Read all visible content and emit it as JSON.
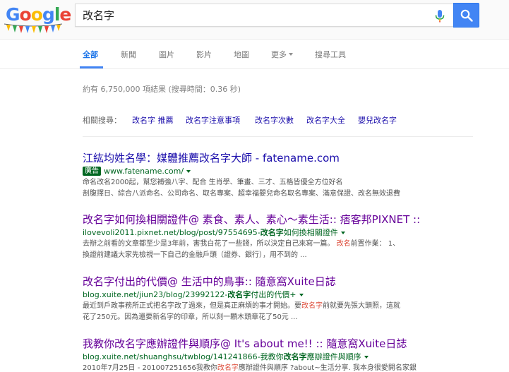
{
  "search": {
    "query": "改名字"
  },
  "tabs": [
    {
      "label": "全部",
      "active": true
    },
    {
      "label": "新聞"
    },
    {
      "label": "圖片"
    },
    {
      "label": "影片"
    },
    {
      "label": "地圖"
    },
    {
      "label": "更多"
    },
    {
      "label": "搜尋工具"
    }
  ],
  "stats": "約有 6,750,000 項結果 (搜尋時間：0.36 秒)",
  "related": {
    "label": "相關搜尋：",
    "links": [
      "改名字 推薦",
      "改名字注意事項",
      "改名字次數",
      "改名字大全",
      "嬰兒改名字"
    ]
  },
  "results": [
    {
      "title": "江紘均姓名學：媒體推薦改名字大師 - fatename.com",
      "ad_label": "廣告",
      "url": "www.fatename.com/",
      "snippet1": "命名改名2000起，幫您補強八字、配合 生肖學、筆畫、三才、五格皆優全方位好名",
      "snippet2": "剖腹擇日、綜合八派命名、公司命名、取名專案、超幸福嬰兒命名取名專案、滿意保證、改名無效退費"
    },
    {
      "title": "改名字如何換相關證件@ 素食、素人、素心～素生活:: 痞客邦PIXNET ::",
      "url_pre": "ilovevoli2011.pixnet.net/blog/post/97554695-",
      "url_bold": "改名字",
      "url_post": "如何換相關證件",
      "snippet1": "去辦之前看的文章都至少是3年前，害我白花了一些錢，所以決定自己來寫一篇。",
      "snippet1_em": "改名",
      "snippet1_post": "前置作業： 1、",
      "snippet2": "換證前建議大家先檢視一下自己的金融戶頭（證券、銀行），用不到的 ..."
    },
    {
      "title": "改名字付出的代價@ 生活中的鳥事:: 隨意窩Xuite日誌",
      "url_pre": "blog.xuite.net/jiun23/blog/23992122-",
      "url_bold": "改名字",
      "url_post": "付出的代價+",
      "snippet1_pre": "最近到戶政事務所正式把名字改了過來，但是真正麻煩的事才開始。要",
      "snippet1_em": "改名字",
      "snippet1_post": "前就要先張大頭照，這就",
      "snippet2": "花了250元。因為還要新名字的印章，所以刻一顆木頭章花了50元 ..."
    },
    {
      "title": "我教你改名字應辦證件與順序@ It's about me!! :: 隨意窩Xuite日誌",
      "url_pre": "blog.xuite.net/shuanghsu/twblog/141241866-我教你",
      "url_bold": "改名字",
      "url_post": "應辦證件與順序",
      "snippet1_pre": "2010年7月25日 - 201007251656我教你",
      "snippet1_em": "改名字",
      "snippet1_post": "應辦證件與順序 ?about~生活分享. 我本身很愛開名家銀"
    }
  ],
  "colors": {
    "link": "#1a0dab",
    "visited": "#660099",
    "url": "#006621",
    "accent": "#4285f4",
    "highlight": "#dd4b39"
  },
  "icons": [
    "google-logo",
    "microphone-icon",
    "search-icon",
    "chevron-down-icon"
  ]
}
